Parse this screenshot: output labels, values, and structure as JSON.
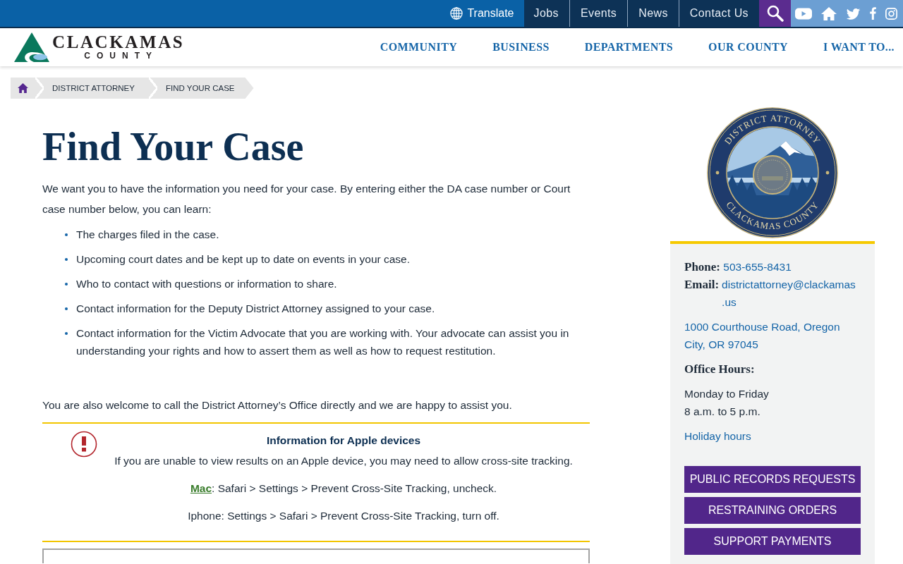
{
  "top_bar": {
    "translate": "Translate",
    "links": [
      {
        "label": "Jobs"
      },
      {
        "label": "Events"
      },
      {
        "label": "News"
      },
      {
        "label": "Contact Us"
      }
    ]
  },
  "header": {
    "logo": {
      "name": "CLACKAMAS",
      "subtitle": "COUNTY"
    },
    "nav": [
      {
        "label": "COMMUNITY"
      },
      {
        "label": "BUSINESS"
      },
      {
        "label": "DEPARTMENTS"
      },
      {
        "label": "OUR COUNTY"
      },
      {
        "label": "I WANT TO..."
      }
    ]
  },
  "breadcrumb": [
    {
      "label": "DISTRICT ATTORNEY"
    },
    {
      "label": "FIND YOUR CASE"
    }
  ],
  "main": {
    "title": "Find Your Case",
    "intro": "We want you to have the information you need for your case. By entering either the DA case number or Court case number below, you can learn:",
    "bullets": [
      "The charges filed in the case.",
      "Upcoming court dates and be kept up to date on events in your case.",
      "Who to contact with questions or information to share.",
      "Contact information for the Deputy District Attorney assigned to your case.",
      "Contact information for the Victim Advocate that you are working with. Your advocate can assist you in understanding your rights and how to assert them as well as how to request restitution."
    ],
    "closing": "You are also welcome to call the District Attorney’s Office directly and we are happy to assist you.",
    "notice": {
      "title": "Information for Apple devices",
      "text": "If you are unable to view results on an Apple device, you may need to allow cross-site tracking.",
      "steps": [
        {
          "link": "Mac",
          "text": ": Safari > Settings > Prevent Cross-Site Tracking, uncheck."
        },
        {
          "text": "Iphone: Settings > Safari > Prevent Cross-Site Tracking, turn off."
        }
      ]
    }
  },
  "sidebar": {
    "seal": {
      "top_text": "DISTRICT ATTORNEY",
      "bottom_text": "CLACKAMAS COUNTY"
    },
    "contact": {
      "phone_label": "Phone:",
      "phone": "503-655-8431",
      "email_label": "Email:",
      "email": "districtattorney@clackamas.us",
      "address": "1000 Courthouse Road, Oregon City, OR 97045",
      "hours_label": "Office Hours:",
      "hours": [
        "Monday to Friday",
        "8 a.m. to 5 p.m."
      ],
      "holiday_link": "Holiday hours"
    },
    "buttons": [
      {
        "label": "PUBLIC RECORDS REQUESTS"
      },
      {
        "label": "RESTRAINING ORDERS"
      },
      {
        "label": "SUPPORT PAYMENTS"
      }
    ]
  }
}
